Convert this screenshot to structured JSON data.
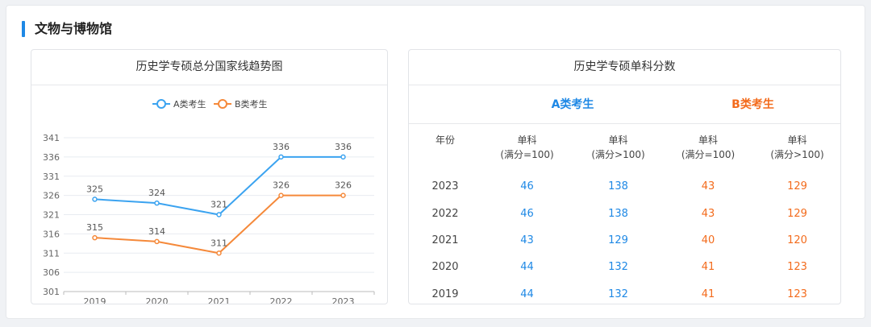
{
  "section": {
    "title": "文物与博物馆"
  },
  "chart": {
    "title": "历史学专硕总分国家线趋势图"
  },
  "chart_data": {
    "type": "line",
    "title": "历史学专硕总分国家线趋势图",
    "xlabel": "",
    "ylabel": "",
    "categories": [
      "2019",
      "2020",
      "2021",
      "2022",
      "2023"
    ],
    "series": [
      {
        "name": "A类考生",
        "values": [
          325,
          324,
          321,
          336,
          336
        ],
        "color": "#3ba3f0"
      },
      {
        "name": "B类考生",
        "values": [
          315,
          314,
          311,
          326,
          326
        ],
        "color": "#f5893a"
      }
    ],
    "ylim": [
      301,
      341
    ],
    "yticks": [
      "301",
      "306",
      "311",
      "316",
      "321",
      "326",
      "331",
      "336",
      "341"
    ],
    "legend": "top-center",
    "grid": true
  },
  "table": {
    "title": "历史学专硕单科分数",
    "group_a": "A类考生",
    "group_b": "B类考生",
    "col_year": "年份",
    "col_single": "单科",
    "col_le100": "(满分=100)",
    "col_gt100": "(满分>100)",
    "rows": [
      {
        "year": "2023",
        "a1": "46",
        "a2": "138",
        "b1": "43",
        "b2": "129"
      },
      {
        "year": "2022",
        "a1": "46",
        "a2": "138",
        "b1": "43",
        "b2": "129"
      },
      {
        "year": "2021",
        "a1": "43",
        "a2": "129",
        "b1": "40",
        "b2": "120"
      },
      {
        "year": "2020",
        "a1": "44",
        "a2": "132",
        "b1": "41",
        "b2": "123"
      },
      {
        "year": "2019",
        "a1": "44",
        "a2": "132",
        "b1": "41",
        "b2": "123"
      }
    ]
  }
}
